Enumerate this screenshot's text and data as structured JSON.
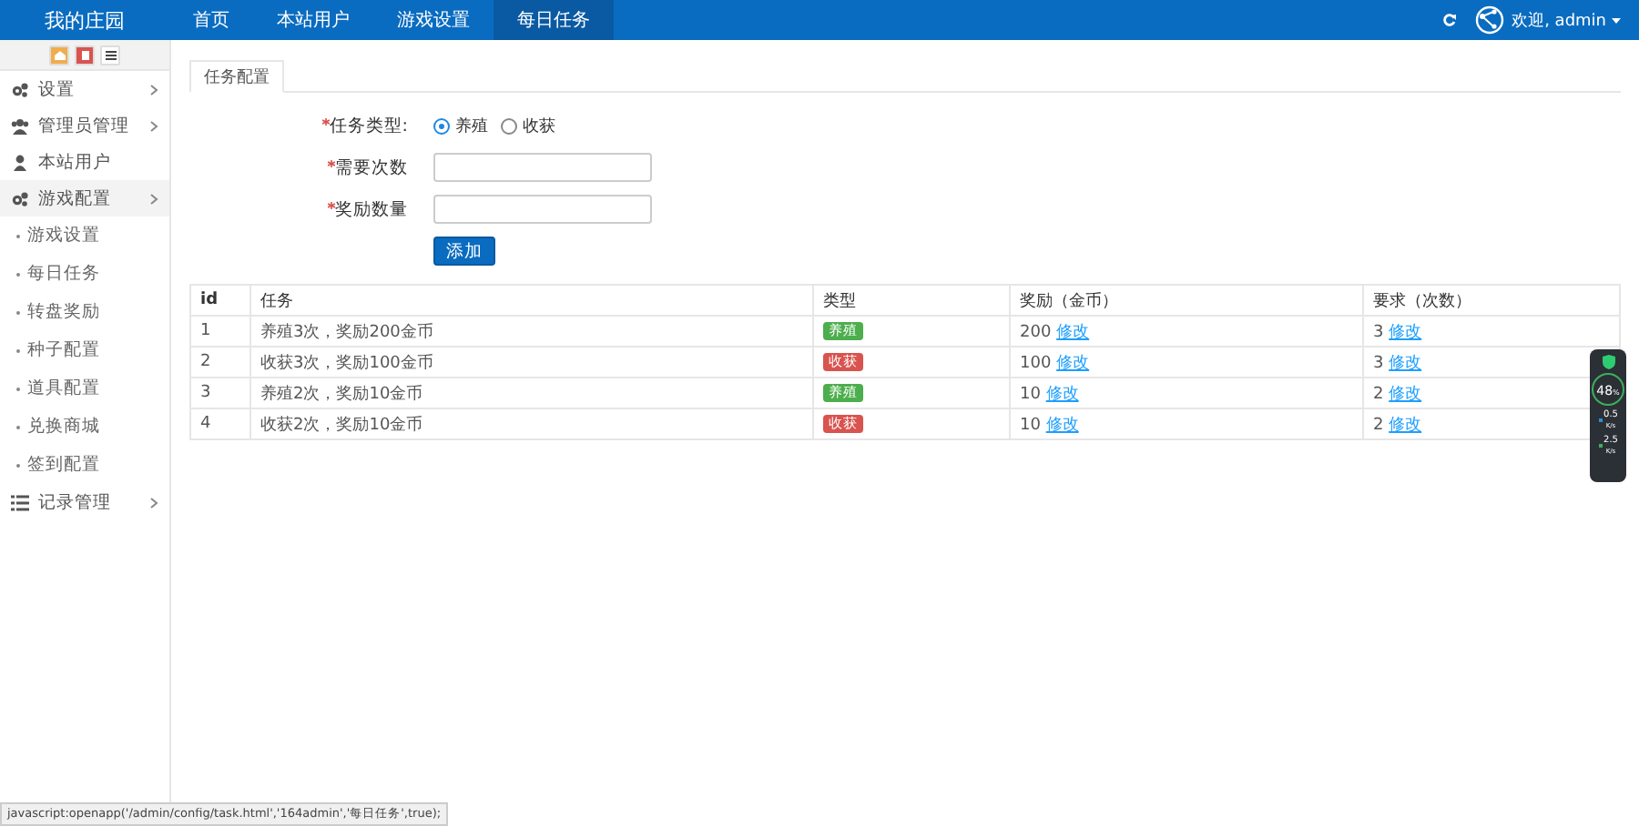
{
  "header": {
    "logo": "我的庄园",
    "nav": [
      {
        "label": "首页",
        "selected": false
      },
      {
        "label": "本站用户",
        "selected": false
      },
      {
        "label": "游戏设置",
        "selected": false
      },
      {
        "label": "每日任务",
        "selected": true
      }
    ],
    "user": "欢迎, admin"
  },
  "sidebar": {
    "shortcuts": [
      {
        "color": "#f0ad4e"
      },
      {
        "color": "#d9534f"
      },
      {
        "color": "#ffffff"
      }
    ],
    "items": [
      {
        "label": "设置",
        "submenu": true,
        "expanded": false
      },
      {
        "label": "管理员管理",
        "submenu": true,
        "expanded": false
      },
      {
        "label": "本站用户",
        "submenu": false,
        "expanded": false
      },
      {
        "label": "游戏配置",
        "submenu": true,
        "expanded": true,
        "children": [
          {
            "label": "游戏设置"
          },
          {
            "label": "每日任务"
          },
          {
            "label": "转盘奖励"
          },
          {
            "label": "种子配置"
          },
          {
            "label": "道具配置"
          },
          {
            "label": "兑换商城"
          },
          {
            "label": "签到配置"
          }
        ]
      },
      {
        "label": "记录管理",
        "submenu": true,
        "expanded": false
      }
    ]
  },
  "tabs": [
    {
      "label": "任务配置",
      "selected": true
    }
  ],
  "form": {
    "fields": [
      {
        "kind": "radio",
        "label": "任务类型:",
        "required": true,
        "options": [
          {
            "label": "养殖",
            "selected": true
          },
          {
            "label": "收获",
            "selected": false
          }
        ]
      },
      {
        "kind": "input",
        "label": "需要次数",
        "required": true
      },
      {
        "kind": "input",
        "label": "奖励数量",
        "required": true
      }
    ],
    "submit": "添加"
  },
  "table": {
    "columns": [
      "id",
      "任务",
      "类型",
      "奖励（金币）",
      "要求（次数）"
    ],
    "rows": [
      {
        "id": "1",
        "task": "养殖3次，奖励200金币",
        "type": {
          "label": "养殖",
          "color": "#4cae4c"
        },
        "reward": "200",
        "reward_link": "修改",
        "requirement": "3",
        "requirement_link": "修改"
      },
      {
        "id": "2",
        "task": "收获3次，奖励100金币",
        "type": {
          "label": "收获",
          "color": "#d9534f"
        },
        "reward": "100",
        "reward_link": "修改",
        "requirement": "3",
        "requirement_link": "修改"
      },
      {
        "id": "3",
        "task": "养殖2次，奖励10金币",
        "type": {
          "label": "养殖",
          "color": "#4cae4c"
        },
        "reward": "10",
        "reward_link": "修改",
        "requirement": "2",
        "requirement_link": "修改"
      },
      {
        "id": "4",
        "task": "收获2次，奖励10金币",
        "type": {
          "label": "收获",
          "color": "#d9534f"
        },
        "reward": "10",
        "reward_link": "修改",
        "requirement": "2",
        "requirement_link": "修改"
      }
    ]
  },
  "monitor": {
    "score": "48",
    "unit": "%",
    "rates": [
      {
        "value": "0.5",
        "unit": "K/s",
        "color": "#2a8fd6"
      },
      {
        "value": "2.5",
        "unit": "K/s",
        "color": "#3cb05a"
      }
    ]
  },
  "status_bar": "javascript:openapp('/admin/config/task.html','164admin','每日任务',true);"
}
